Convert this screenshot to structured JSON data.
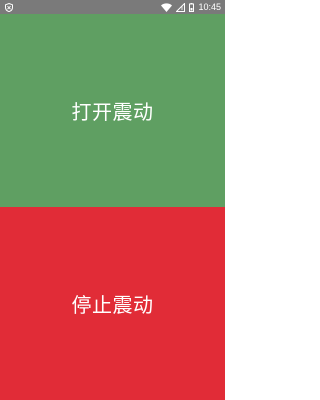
{
  "status_bar": {
    "time": "10:45",
    "icons": [
      "shield-icon",
      "wifi-icon",
      "no-sim-icon",
      "battery-icon"
    ]
  },
  "buttons": {
    "vibrate_on_label": "打开震动",
    "vibrate_off_label": "停止震动"
  },
  "colors": {
    "status_bar": "#7a7a7a",
    "vibrate_on_bg": "#5f9f62",
    "vibrate_off_bg": "#e12c37",
    "text": "#ffffff"
  }
}
